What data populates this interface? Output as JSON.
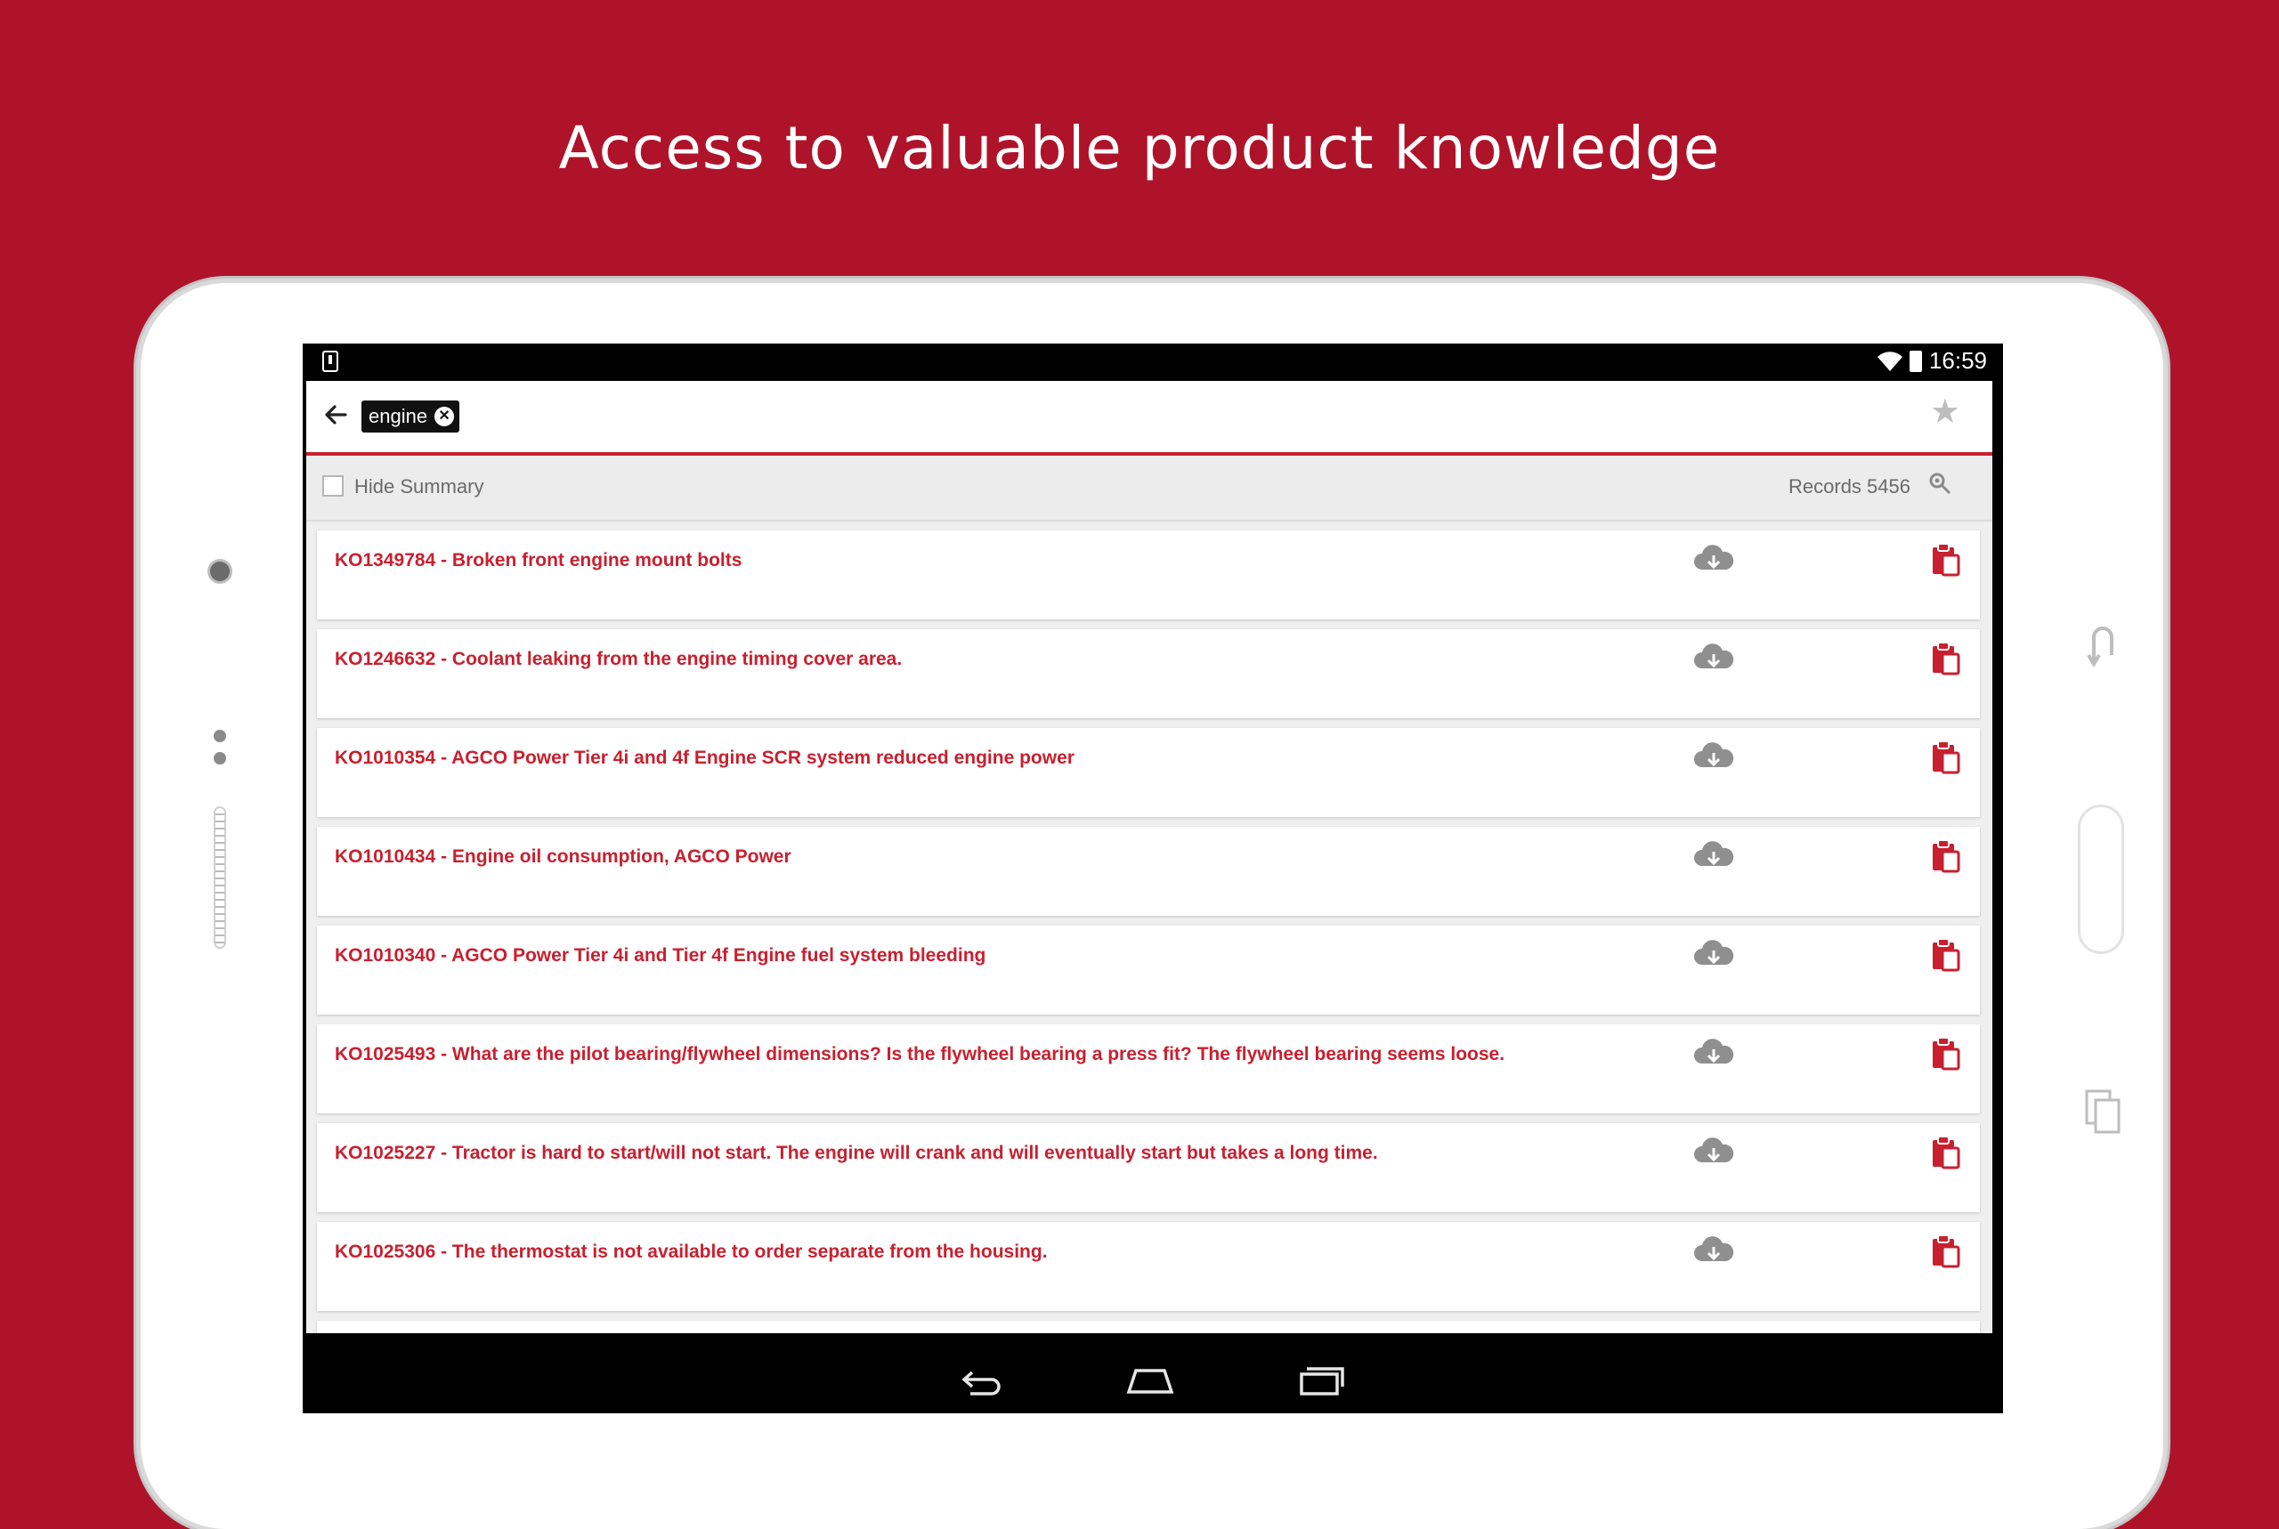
{
  "headline": "Access to valuable product knowledge",
  "status": {
    "time": "16:59"
  },
  "toolbar": {
    "search_chip": "engine"
  },
  "summary": {
    "hide_label": "Hide Summary",
    "records": "Records 5456"
  },
  "results": [
    {
      "title": "KO1349784 - Broken front engine mount bolts"
    },
    {
      "title": "KO1246632 - Coolant leaking from the engine timing cover area."
    },
    {
      "title": "KO1010354 - AGCO Power Tier 4i and 4f Engine SCR system reduced engine power"
    },
    {
      "title": "KO1010434 - Engine oil consumption, AGCO Power"
    },
    {
      "title": "KO1010340 - AGCO Power Tier 4i and Tier 4f Engine fuel system bleeding"
    },
    {
      "title": "KO1025493 - What are the pilot bearing/flywheel dimensions? Is the flywheel bearing a press fit? The flywheel bearing seems loose."
    },
    {
      "title": "KO1025227 - Tractor is hard to start/will not start. The engine will crank and will eventually start but takes a long time."
    },
    {
      "title": "KO1025306 - The thermostat is not available to order separate from the housing."
    }
  ],
  "colors": {
    "background": "#ae132a",
    "accent": "#c8202f"
  },
  "icons": [
    "back-arrow-icon",
    "clear-icon",
    "star-icon",
    "checkbox-icon",
    "search-settings-icon",
    "cloud-download-icon",
    "clipboard-icon",
    "nav-back-icon",
    "nav-home-icon",
    "nav-recents-icon"
  ]
}
